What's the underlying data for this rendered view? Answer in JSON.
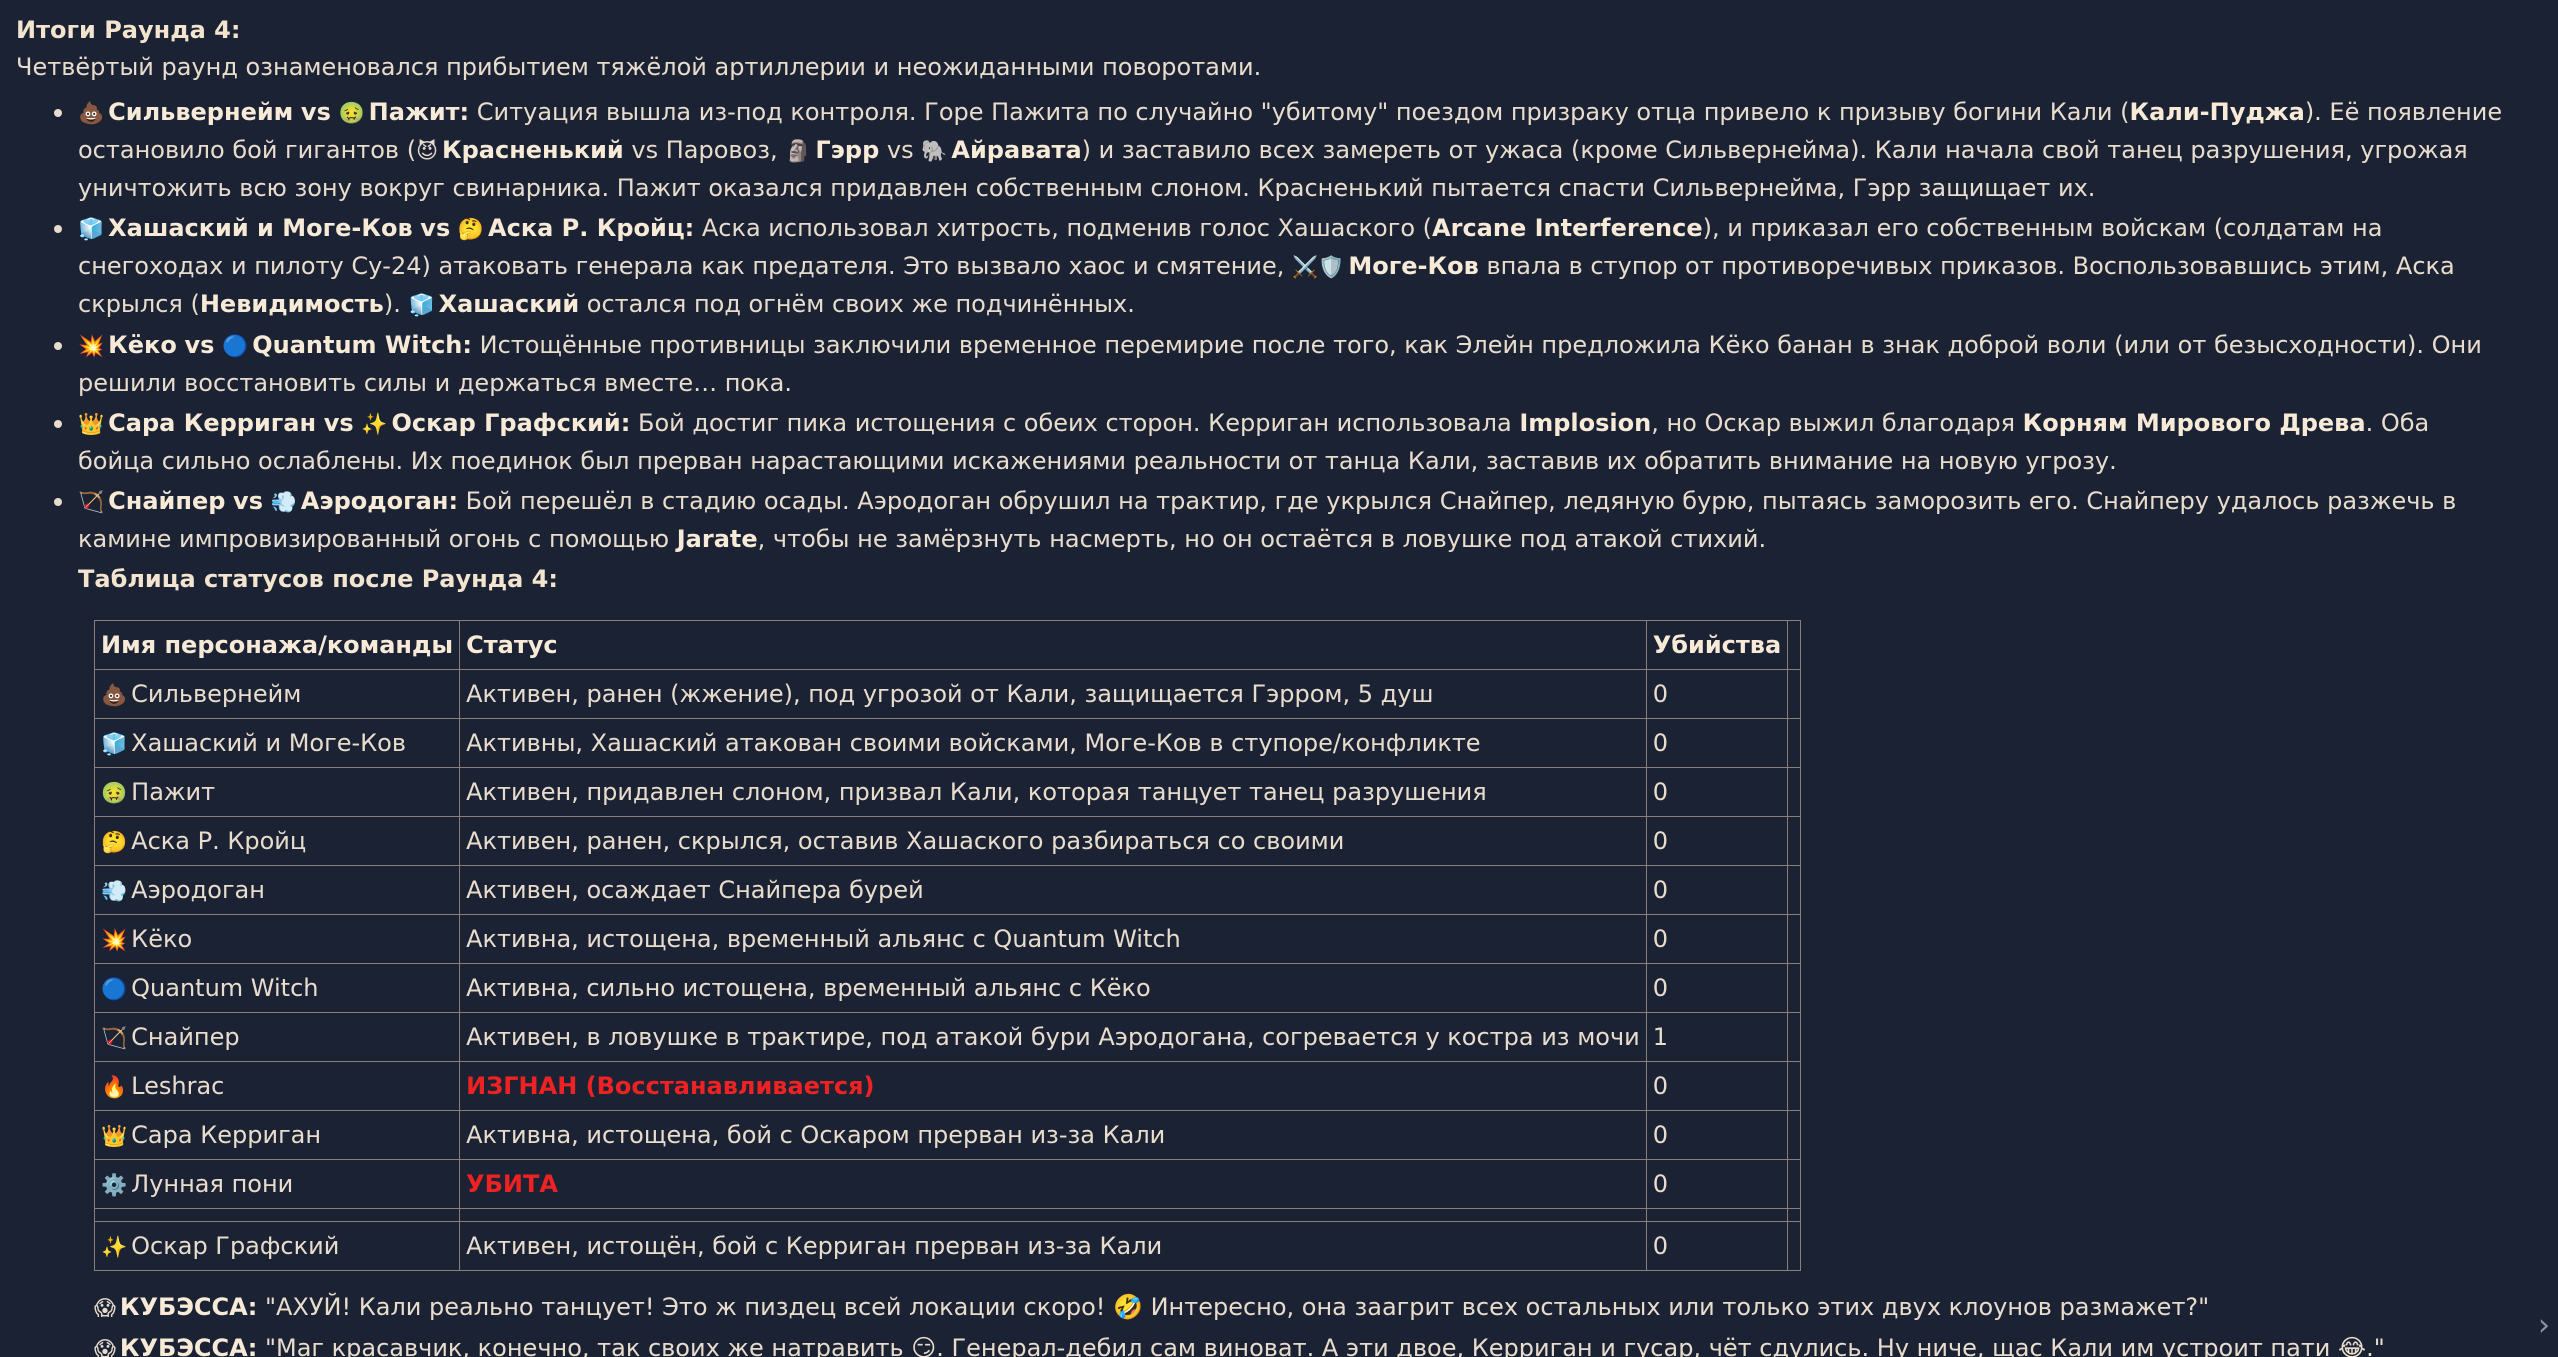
{
  "title": "Итоги Раунда 4:",
  "intro": "Четвёртый раунд ознаменовался прибытием тяжёлой артиллерии и неожиданными поворотами.",
  "rounds": [
    {
      "e1": "💩",
      "name1": "Сильвернейм",
      "vs": "vs",
      "e2": "🤢",
      "name2": "Пажит:",
      "p1": " Ситуация вышла из-под контроля. Горе Пажита по случайно \"убитому\" поездом призраку отца привело к призыву богини Кали (",
      "b1": "Кали-Пуджа",
      "p2": "). Её появление остановило бой гигантов (",
      "e3": "😈",
      "b2": "Красненький",
      "p3": " vs Паровоз, ",
      "e4": "🗿",
      "b3": "Гэрр",
      "p4": " vs ",
      "e5": "🐘",
      "b4": "Айравата",
      "p5": ") и заставило всех замереть от ужаса (кроме Сильвернейма). Кали начала свой танец разрушения, угрожая уничтожить всю зону вокруг свинарника. Пажит оказался придавлен собственным слоном. Красненький пытается спасти Сильвернейма, Гэрр защищает их."
    },
    {
      "e1": "🧊",
      "name1": "Хашаский и Моге-Ков",
      "vs": "vs",
      "e2": "🤔",
      "name2": "Аска Р. Кройц:",
      "p1": " Аска использовал хитрость, подменив голос Хашаского (",
      "b1": "Arcane Interference",
      "p2": "), и приказал его собственным войскам (солдатам на снегоходах и пилоту Су-24) атаковать генерала как предателя. Это вызвало хаос и смятение, ",
      "e3": "⚔️🛡️",
      "b2": "Моге-Ков",
      "p3": " впала в ступор от противоречивых приказов. Воспользовавшись этим, Аска скрылся (",
      "b3": "Невидимость",
      "p4": "). ",
      "e4": "🧊",
      "b4": "Хашаский",
      "p5": " остался под огнём своих же подчинённых."
    },
    {
      "e1": "💥",
      "name1": "Кёко",
      "vs": "vs",
      "e2": "🔵",
      "name2": "Quantum Witch:",
      "p1": " Истощённые противницы заключили временное перемирие после того, как Элейн предложила Кёко банан в знак доброй воли (или от безысходности). Они решили восстановить силы и держаться вместе… пока."
    },
    {
      "e1": "👑",
      "name1": "Сара Керриган",
      "vs": "vs",
      "e2": "✨",
      "name2": "Оскар Графский:",
      "p1": " Бой достиг пика истощения с обеих сторон. Керриган использовала ",
      "b1": "Implosion",
      "p2": ", но Оскар выжил благодаря ",
      "b2": "Корням Мирового Древа",
      "p3": ". Оба бойца сильно ослаблены. Их поединок был прерван нарастающими искажениями реальности от танца Кали, заставив их обратить внимание на новую угрозу."
    },
    {
      "e1": "🏹",
      "name1": "Снайпер",
      "vs": "vs",
      "e2": "💨",
      "name2": "Аэродоган:",
      "p1": " Бой перешёл в стадию осады. Аэродоган обрушил на трактир, где укрылся Снайпер, ледяную бурю, пытаясь заморозить его. Снайперу удалось разжечь в камине импровизированный огонь с помощью ",
      "b1": "Jarate",
      "p2": ", чтобы не замёрзнуть насмерть, но он остаётся в ловушке под атакой стихий."
    }
  ],
  "table_title": "Таблица статусов после Раунда 4:",
  "table": {
    "headers": [
      "Имя персонажа/команды",
      "Статус",
      "Убийства"
    ],
    "rows": [
      {
        "icon": "💩",
        "name": "Сильвернейм",
        "status": "Активен, ранен (жжение), под угрозой от Кали, защищается Гэрром, 5 душ",
        "kills": "0"
      },
      {
        "icon": "🧊",
        "name": "Хашаский и Моге-Ков",
        "status": "Активны, Хашаский атакован своими войсками, Моге-Ков в ступоре/конфликте",
        "kills": "0"
      },
      {
        "icon": "🤢",
        "name": "Пажит",
        "status": "Активен, придавлен слоном, призвал Кали, которая танцует танец разрушения",
        "kills": "0"
      },
      {
        "icon": "🤔",
        "name": "Аска Р. Кройц",
        "status": "Активен, ранен, скрылся, оставив Хашаского разбираться со своими",
        "kills": "0"
      },
      {
        "icon": "💨",
        "name": "Аэродоган",
        "status": "Активен, осаждает Снайпера бурей",
        "kills": "0"
      },
      {
        "icon": "💥",
        "name": "Кёко",
        "status": "Активна, истощена, временный альянс с Quantum Witch",
        "kills": "0"
      },
      {
        "icon": "🔵",
        "name": "Quantum Witch",
        "status": "Активна, сильно истощена, временный альянс с Кёко",
        "kills": "0"
      },
      {
        "icon": "🏹",
        "name": "Снайпер",
        "status": "Активен, в ловушке в трактире, под атакой бури Аэродогана, согревается у костра из мочи",
        "kills": "1"
      },
      {
        "icon": "🔥",
        "name": "Leshrac",
        "status": "ИЗГНАН (Восстанавливается)",
        "kills": "0",
        "highlight": true
      },
      {
        "icon": "👑",
        "name": "Сара Керриган",
        "status": "Активна, истощена, бой с Оскаром прерван из-за Кали",
        "kills": "0"
      },
      {
        "icon": "⚙️",
        "name": "Лунная пони",
        "status": "УБИТА",
        "kills": "0",
        "highlight": true
      },
      {
        "icon": "✨",
        "name": "Оскар Графский",
        "status": "Активен, истощён, бой с Керриган прерван из-за Кали",
        "kills": "0"
      }
    ]
  },
  "comments": [
    {
      "icon": "😱",
      "author": "КУБЭССА:",
      "text": " \"АХУЙ! Кали реально танцует! Это ж пиздец всей локации скоро! 🤣 Интересно, она заагрит всех остальных или только этих двух клоунов размажет?\""
    },
    {
      "icon": "😱",
      "author": "КУБЭССА:",
      "text": " \"Маг красавчик, конечно, так своих же натравить 😏. Генерал-дебил сам виноват. А эти двое, Керриган и гусар, чёт сдулись. Ну ниче, щас Кали им устроит пати 😂.\""
    }
  ],
  "scroll_arrow": "›",
  "colors": {
    "background": "#1b2233",
    "text": "#e8dccc",
    "alert": "#ee2222"
  }
}
